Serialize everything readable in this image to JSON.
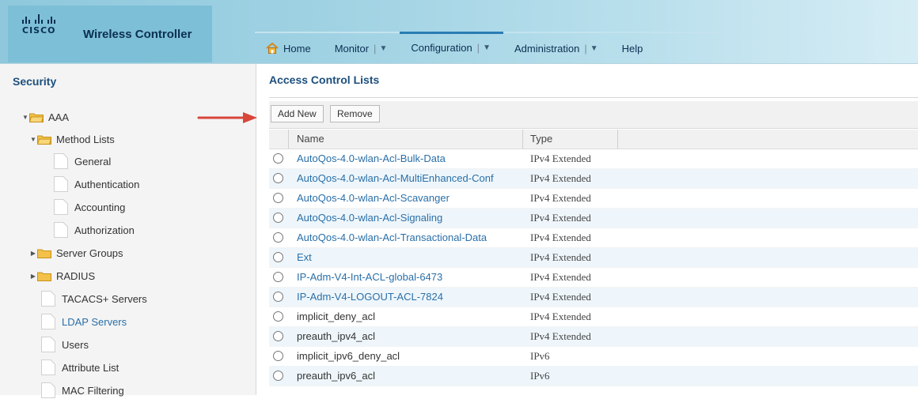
{
  "header": {
    "logo_text": "CISCO",
    "app_title": "Wireless Controller",
    "nav": [
      {
        "label": "Home",
        "has_menu": false,
        "active": false
      },
      {
        "label": "Monitor",
        "has_menu": true,
        "active": false
      },
      {
        "label": "Configuration",
        "has_menu": true,
        "active": true
      },
      {
        "label": "Administration",
        "has_menu": true,
        "active": false
      },
      {
        "label": "Help",
        "has_menu": false,
        "active": false
      }
    ],
    "menu_separator": "|",
    "caret": "▼"
  },
  "sidebar": {
    "title": "Security",
    "items": [
      {
        "label": "AAA",
        "type": "folder",
        "expanded": true
      },
      {
        "label": "Method Lists",
        "type": "folder",
        "expanded": true
      },
      {
        "label": "General",
        "type": "doc"
      },
      {
        "label": "Authentication",
        "type": "doc"
      },
      {
        "label": "Accounting",
        "type": "doc"
      },
      {
        "label": "Authorization",
        "type": "doc"
      },
      {
        "label": "Server Groups",
        "type": "folder",
        "expanded": false
      },
      {
        "label": "RADIUS",
        "type": "folder",
        "expanded": false
      },
      {
        "label": "TACACS+ Servers",
        "type": "doc"
      },
      {
        "label": "LDAP Servers",
        "type": "doc",
        "selected": true
      },
      {
        "label": "Users",
        "type": "doc"
      },
      {
        "label": "Attribute List",
        "type": "doc"
      },
      {
        "label": "MAC Filtering",
        "type": "doc"
      }
    ]
  },
  "main": {
    "title": "Access Control Lists",
    "toolbar": {
      "add_label": "Add New",
      "remove_label": "Remove"
    },
    "columns": {
      "name": "Name",
      "type": "Type"
    },
    "rows": [
      {
        "name": "AutoQos-4.0-wlan-Acl-Bulk-Data",
        "type": "IPv4 Extended",
        "link": true
      },
      {
        "name": "AutoQos-4.0-wlan-Acl-MultiEnhanced-Conf",
        "type": "IPv4 Extended",
        "link": true
      },
      {
        "name": "AutoQos-4.0-wlan-Acl-Scavanger",
        "type": "IPv4 Extended",
        "link": true
      },
      {
        "name": "AutoQos-4.0-wlan-Acl-Signaling",
        "type": "IPv4 Extended",
        "link": true
      },
      {
        "name": "AutoQos-4.0-wlan-Acl-Transactional-Data",
        "type": "IPv4 Extended",
        "link": true
      },
      {
        "name": "Ext",
        "type": "IPv4 Extended",
        "link": true
      },
      {
        "name": "IP-Adm-V4-Int-ACL-global-6473",
        "type": "IPv4 Extended",
        "link": true
      },
      {
        "name": "IP-Adm-V4-LOGOUT-ACL-7824",
        "type": "IPv4 Extended",
        "link": true
      },
      {
        "name": "implicit_deny_acl",
        "type": "IPv4 Extended",
        "link": false
      },
      {
        "name": "preauth_ipv4_acl",
        "type": "IPv4 Extended",
        "link": false
      },
      {
        "name": "implicit_ipv6_deny_acl",
        "type": "IPv6",
        "link": false
      },
      {
        "name": "preauth_ipv6_acl",
        "type": "IPv6",
        "link": false
      }
    ]
  },
  "colors": {
    "link": "#2a6fa8",
    "accent": "#2a7db4",
    "title": "#1c4f7d",
    "alert_arrow": "#d9463a"
  }
}
